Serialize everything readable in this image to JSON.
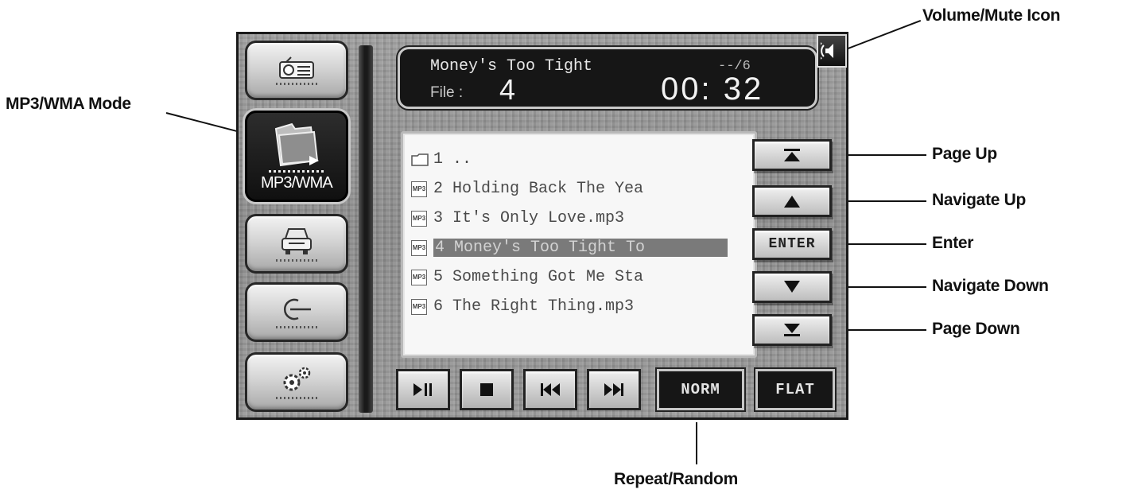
{
  "callouts": {
    "volume": "Volume/Mute Icon",
    "mode": "MP3/WMA Mode",
    "page_up": "Page Up",
    "navigate_up": "Navigate Up",
    "enter": "Enter",
    "navigate_down": "Navigate Down",
    "page_down": "Page Down",
    "repeat_random": "Repeat/Random"
  },
  "sidebar": {
    "items": [
      {
        "name": "radio",
        "icon": "radio-icon",
        "label": ""
      },
      {
        "name": "mp3-wma",
        "icon": "folder-icon",
        "label": "MP3/WMA",
        "active": true
      },
      {
        "name": "car",
        "icon": "car-icon",
        "label": ""
      },
      {
        "name": "input",
        "icon": "input-icon",
        "label": ""
      },
      {
        "name": "settings",
        "icon": "gears-icon",
        "label": ""
      }
    ]
  },
  "now_playing": {
    "title": "Money's Too Tight",
    "track_count": "--/6",
    "file_label": "File  :",
    "file_number": "4",
    "elapsed": "00: 32"
  },
  "file_list": {
    "items": [
      {
        "type": "folder",
        "text": "1 .."
      },
      {
        "type": "mp3",
        "text": "2 Holding Back The Yea"
      },
      {
        "type": "mp3",
        "text": "3 It's Only Love.mp3"
      },
      {
        "type": "mp3",
        "text": "4 Money's Too Tight To",
        "selected": true
      },
      {
        "type": "mp3",
        "text": "5 Something Got Me Sta"
      },
      {
        "type": "mp3",
        "text": "6 The Right Thing.mp3"
      }
    ]
  },
  "nav": {
    "enter_label": "ENTER"
  },
  "transport": {
    "norm_label": "NORM",
    "flat_label": "FLAT"
  },
  "colors": {
    "panel": "#8f8f8f",
    "lcd": "#161616",
    "selection": "#7a7a7a"
  }
}
